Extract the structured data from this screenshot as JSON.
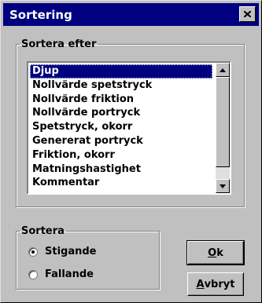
{
  "dialog": {
    "title": "Sortering",
    "close_symbol": "×"
  },
  "sort_by": {
    "legend": "Sortera efter",
    "items": [
      "Djup",
      "Nollvärde spetstryck",
      "Nollvärde friktion",
      "Nollvärde portryck",
      "Spetstryck, okorr",
      "Genererat portryck",
      "Friktion, okorr",
      "Matningshastighet",
      "Kommentar"
    ],
    "selected_index": 0
  },
  "order": {
    "legend": "Sortera",
    "options": [
      {
        "label": "Stigande",
        "checked": true
      },
      {
        "label": "Fallande",
        "checked": false
      }
    ]
  },
  "buttons": {
    "ok_mnemonic": "O",
    "ok_rest": "k",
    "cancel_mnemonic": "A",
    "cancel_rest": "vbryt"
  },
  "icons": {
    "close": "close-icon",
    "scroll_up": "triangle-up-icon",
    "scroll_down": "triangle-down-icon"
  },
  "colors": {
    "titlebar": "#000080",
    "face": "#c0c0c0",
    "selection": "#000080"
  }
}
